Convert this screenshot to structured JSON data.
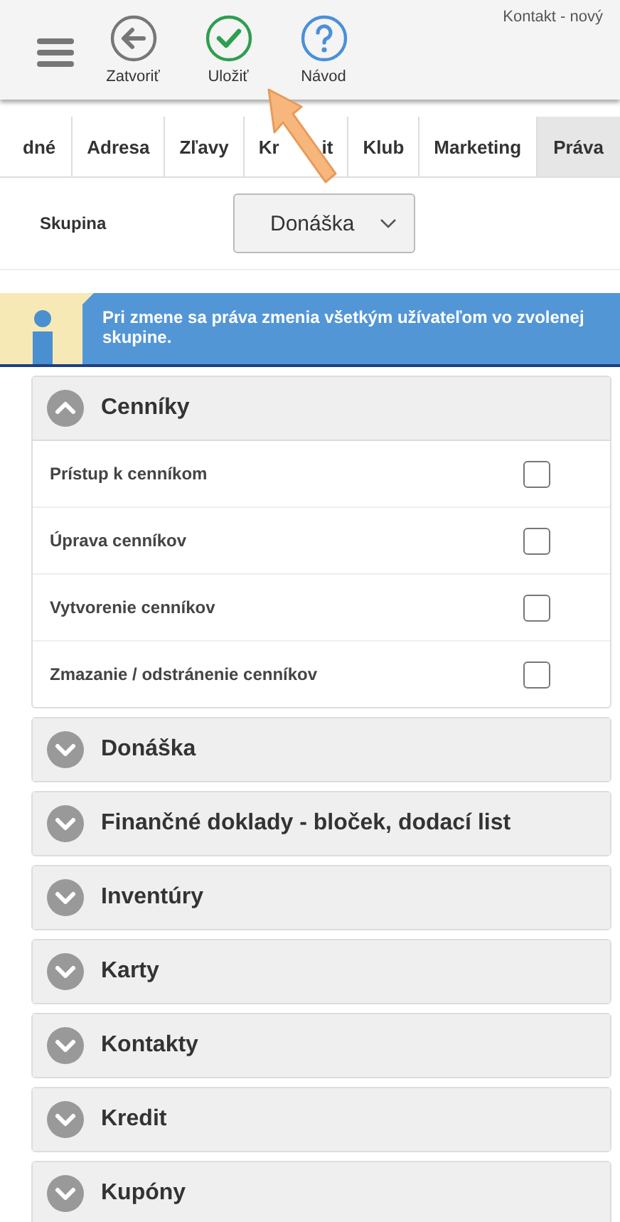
{
  "header": {
    "title": "Kontakt - nový",
    "actions": [
      {
        "kind": "back",
        "label": "Zatvoriť"
      },
      {
        "kind": "check",
        "label": "Uložiť"
      },
      {
        "kind": "help",
        "label": "Návod"
      }
    ]
  },
  "tabs": [
    {
      "label": "dné",
      "selected": false
    },
    {
      "label": "Adresa",
      "selected": false
    },
    {
      "label": "Zľavy",
      "selected": false
    },
    {
      "parts": [
        "Kr",
        "it"
      ],
      "selected": false
    },
    {
      "label": "Klub",
      "selected": false
    },
    {
      "label": "Marketing",
      "selected": false
    },
    {
      "label": "Práva",
      "selected": true
    }
  ],
  "group": {
    "label": "Skupina",
    "value": "Donáška"
  },
  "info": {
    "text": "Pri zmene sa práva zmenia všetkým užívateľom vo zvolenej skupine."
  },
  "sections": [
    {
      "title": "Cenníky",
      "expanded": true,
      "items": [
        {
          "label": "Prístup k cenníkom",
          "checked": false
        },
        {
          "label": "Úprava cenníkov",
          "checked": false
        },
        {
          "label": "Vytvorenie cenníkov",
          "checked": false
        },
        {
          "label": "Zmazanie / odstránenie cenníkov",
          "checked": false
        }
      ]
    },
    {
      "title": "Donáška",
      "expanded": false
    },
    {
      "title": "Finančné doklady - bloček, dodací list",
      "expanded": false
    },
    {
      "title": "Inventúry",
      "expanded": false
    },
    {
      "title": "Karty",
      "expanded": false
    },
    {
      "title": "Kontakty",
      "expanded": false
    },
    {
      "title": "Kredit",
      "expanded": false
    },
    {
      "title": "Kupóny",
      "expanded": false
    }
  ]
}
